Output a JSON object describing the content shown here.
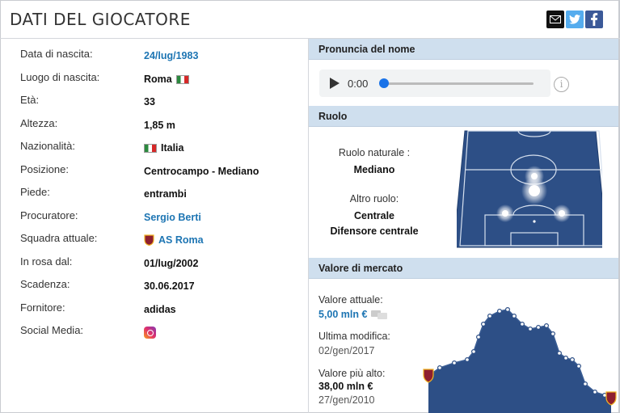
{
  "header": {
    "title": "DATI DEL GIOCATORE"
  },
  "share": [
    "envelope-icon",
    "twitter-icon",
    "facebook-icon"
  ],
  "details": [
    {
      "label": "Data di nascita:",
      "value": "24/lug/1983",
      "link": true
    },
    {
      "label": "Luogo di nascita:",
      "value": "Roma",
      "flag": true
    },
    {
      "label": "Età:",
      "value": "33"
    },
    {
      "label": "Altezza:",
      "value": "1,85 m"
    },
    {
      "label": "Nazionalità:",
      "value": "Italia",
      "flag": true
    },
    {
      "label": "Posizione:",
      "value": "Centrocampo - Mediano"
    },
    {
      "label": "Piede:",
      "value": "entrambi"
    },
    {
      "label": "Procuratore:",
      "value": "Sergio Berti",
      "link": true
    },
    {
      "label": "Squadra attuale:",
      "value": "AS Roma",
      "link": true,
      "crest": true
    },
    {
      "label": "In rosa dal:",
      "value": "01/lug/2002"
    },
    {
      "label": "Scadenza:",
      "value": "30.06.2017"
    },
    {
      "label": "Fornitore:",
      "value": "adidas"
    },
    {
      "label": "Social Media:",
      "value": "",
      "instagram": true
    }
  ],
  "pronunciation": {
    "title": "Pronuncia del nome",
    "time": "0:00",
    "progress": 0
  },
  "role": {
    "title": "Ruolo",
    "natural_label": "Ruolo naturale :",
    "natural_value": "Mediano",
    "other_label": "Altro ruolo:",
    "other_values": [
      "Centrale",
      "Difensore centrale"
    ]
  },
  "market": {
    "title": "Valore di mercato",
    "current_label": "Valore attuale:",
    "current_value": "5,00 mln €",
    "modified_label": "Ultima modifica:",
    "modified_value": "02/gen/2017",
    "highest_label": "Valore più alto:",
    "highest_value": "38,00 mln €",
    "highest_date": "27/gen/2010"
  },
  "colors": {
    "link": "#1d75b3",
    "panel_header": "#cfdfee",
    "pitch": "#2d4f86",
    "chart_fill": "#2d4f86"
  }
}
